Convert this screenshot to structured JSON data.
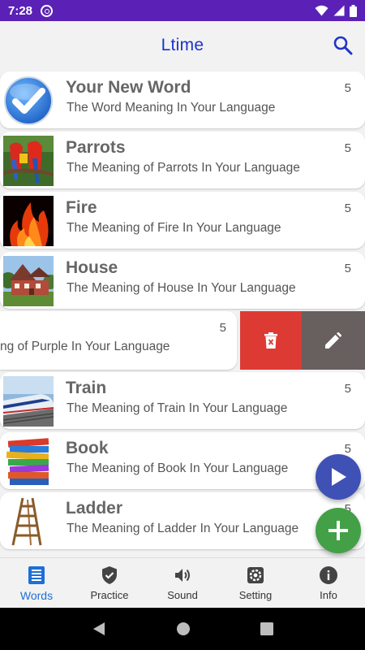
{
  "status": {
    "time": "7:28"
  },
  "app": {
    "title": "Ltime"
  },
  "words": [
    {
      "word": "Your New Word",
      "meaning": "The Word Meaning In Your Language",
      "count": "5",
      "icon": "checkmark-icon"
    },
    {
      "word": "Parrots",
      "meaning": "The Meaning of Parrots In Your Language",
      "count": "5",
      "icon": "parrots-image"
    },
    {
      "word": "Fire",
      "meaning": "The Meaning of Fire In Your Language",
      "count": "5",
      "icon": "fire-image"
    },
    {
      "word": "House",
      "meaning": "The Meaning of House In Your Language",
      "count": "5",
      "icon": "house-image"
    },
    {
      "word": "Train",
      "meaning": "The Meaning of Train In Your Language",
      "count": "5",
      "icon": "train-image"
    },
    {
      "word": "Book",
      "meaning": "The Meaning of Book In Your Language",
      "count": "5",
      "icon": "books-image"
    },
    {
      "word": "Ladder",
      "meaning": "The Meaning of Ladder In Your Language",
      "count": "5",
      "icon": "ladder-image"
    }
  ],
  "swiped_item": {
    "meaning_visible": "ng of Purple In Your Language",
    "count": "5"
  },
  "nav": {
    "words": "Words",
    "practice": "Practice",
    "sound": "Sound",
    "setting": "Setting",
    "info": "Info",
    "active": "words"
  },
  "colors": {
    "status_bar": "#5b21b6",
    "title": "#1e34c9",
    "delete": "#de3a34",
    "edit": "#685f5f",
    "fab_play": "#3f51b5",
    "fab_add": "#43a047",
    "nav_active": "#1e6fd6"
  }
}
